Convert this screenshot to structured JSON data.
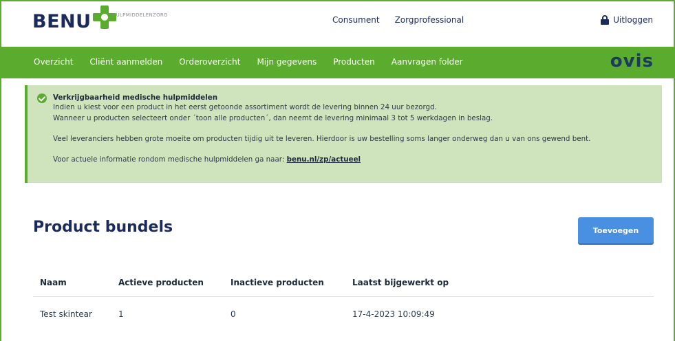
{
  "brand": {
    "name": "BENU",
    "subtitle": "HULPMIDDELENZORG",
    "partner": "OVIS",
    "colors": {
      "primary_green": "#5aab2e",
      "navy": "#1b2a5c",
      "button_blue": "#4a90e2",
      "notice_bg": "#cfe4bd"
    }
  },
  "top_nav": {
    "items": [
      "Consument",
      "Zorgprofessional"
    ],
    "logout_label": "Uitloggen",
    "logout_icon": "lock-icon"
  },
  "main_nav": {
    "items": [
      "Overzicht",
      "Cliënt aanmelden",
      "Orderoverzicht",
      "Mijn gegevens",
      "Producten",
      "Aanvragen folder"
    ]
  },
  "notice": {
    "icon": "check-circle-icon",
    "title": "Verkrijgbaarheid medische hulpmiddelen",
    "line1": "Indien u kiest voor een product in het eerst getoonde assortiment wordt de levering binnen 24 uur bezorgd.",
    "line2": "Wanneer u producten selecteert onder ´toon alle producten´, dan neemt de levering minimaal 3 tot 5 werkdagen in beslag.",
    "line3": "Veel leveranciers hebben grote moeite om producten tijdig uit te leveren. Hierdoor is uw bestelling soms langer onderweg dan u van ons gewend bent.",
    "line4_prefix": "Voor actuele informatie rondom medische hulpmiddelen ga naar: ",
    "link_text": "benu.nl/zp/actueel"
  },
  "page": {
    "title": "Product bundels",
    "add_button": "Toevoegen"
  },
  "table": {
    "columns": [
      "Naam",
      "Actieve producten",
      "Inactieve producten",
      "Laatst bijgewerkt op"
    ],
    "rows": [
      [
        "Test skintear",
        "1",
        "0",
        "17-4-2023 10:09:49"
      ]
    ]
  }
}
